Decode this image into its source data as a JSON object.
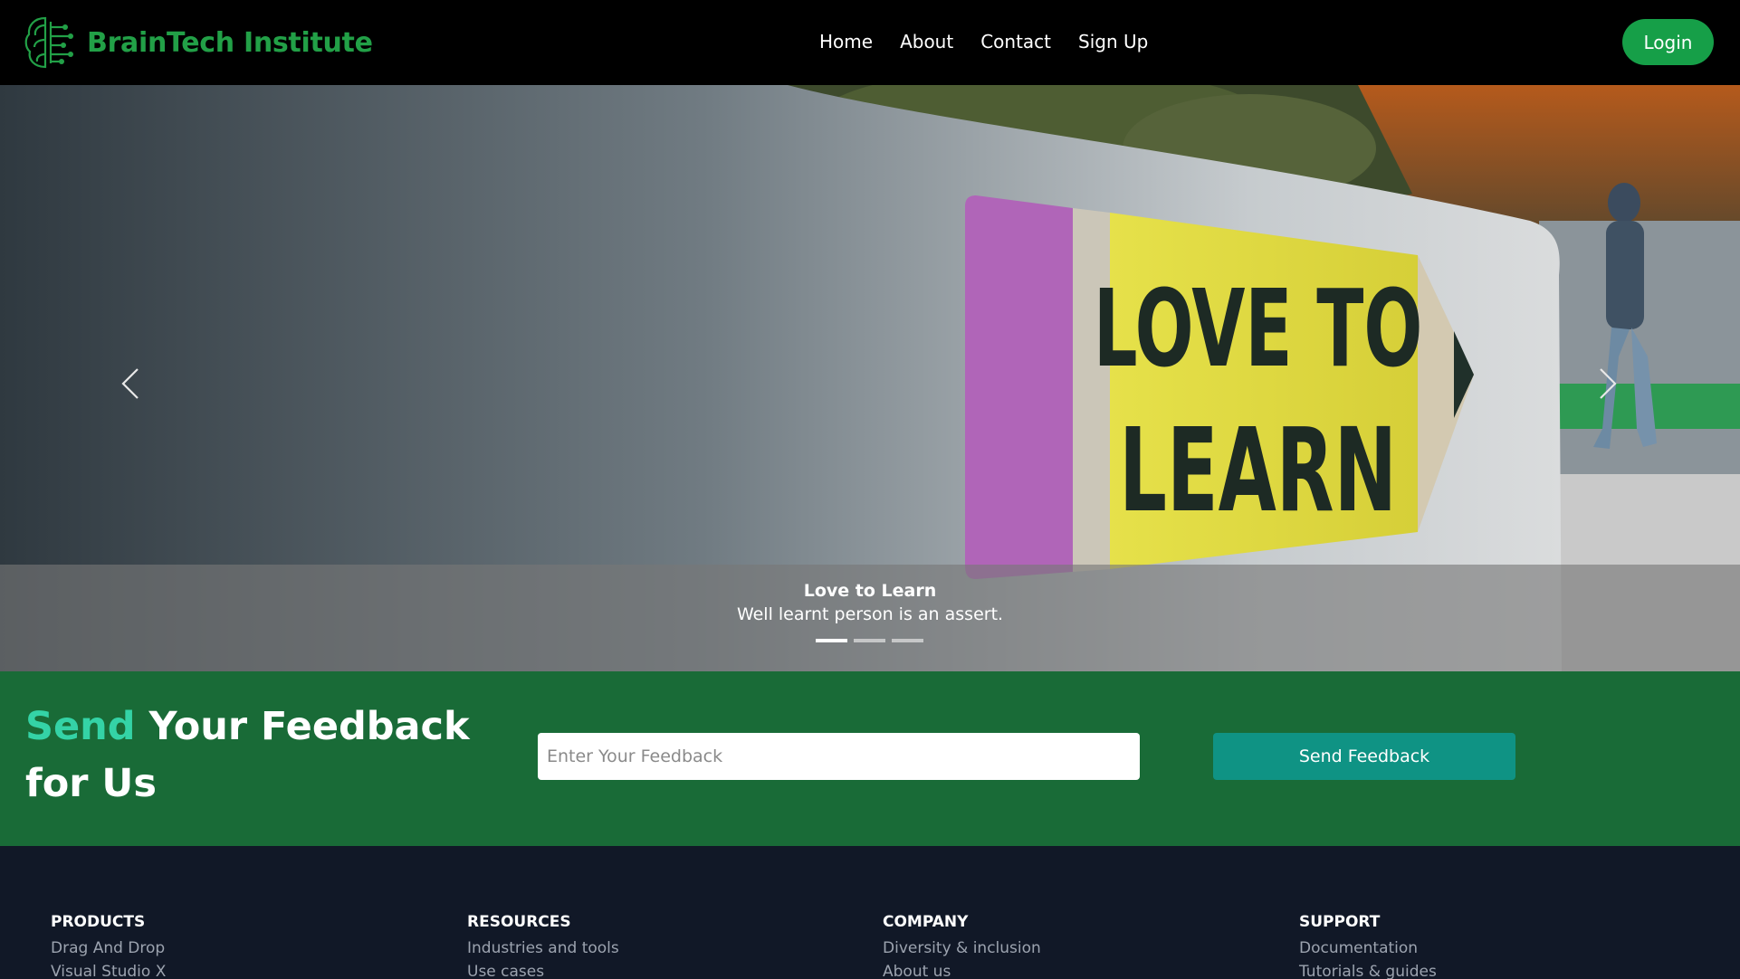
{
  "brand": {
    "name": "BrainTech Institute",
    "logo_icon": "brain-circuit-icon",
    "color": "#22a047"
  },
  "nav": {
    "links": [
      "Home",
      "About",
      "Contact",
      "Sign Up"
    ],
    "login_label": "Login",
    "login_color": "#169f48"
  },
  "hero": {
    "sign_text_line1": "LOVE TO",
    "sign_text_line2": "LEARN",
    "caption_title": "Love to Learn",
    "caption_text": "Well learnt person is an assert.",
    "slide_count": 3,
    "active_slide": 1,
    "prev_icon": "chevron-left-icon",
    "next_icon": "chevron-right-icon"
  },
  "feedback": {
    "heading_accent": "Send",
    "heading_rest": " Your Feedback for Us",
    "input_placeholder": "Enter Your Feedback",
    "input_value": "",
    "button_label": "Send Feedback",
    "accent_color": "#34d3a6",
    "background_color": "#196b37",
    "button_color": "#0f9384"
  },
  "footer": {
    "columns": [
      {
        "title": "PRODUCTS",
        "links": [
          "Drag And Drop",
          "Visual Studio X"
        ]
      },
      {
        "title": "RESOURCES",
        "links": [
          "Industries and tools",
          "Use cases"
        ]
      },
      {
        "title": "COMPANY",
        "links": [
          "Diversity & inclusion",
          "About us"
        ]
      },
      {
        "title": "SUPPORT",
        "links": [
          "Documentation",
          "Tutorials & guides"
        ]
      }
    ]
  }
}
